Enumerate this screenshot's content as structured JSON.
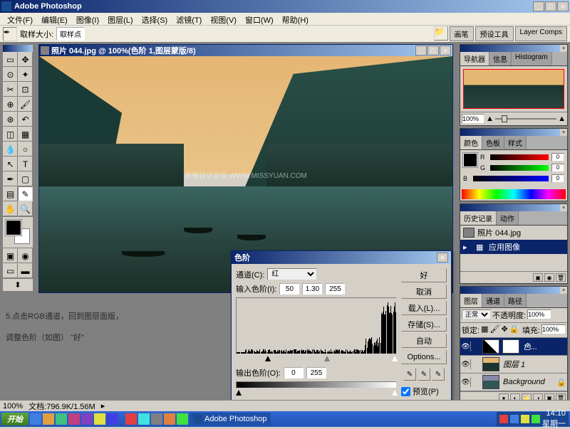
{
  "app": {
    "title": "Adobe Photoshop"
  },
  "menu": [
    "文件(F)",
    "编辑(E)",
    "图像(I)",
    "图层(L)",
    "选择(S)",
    "滤镜(T)",
    "视图(V)",
    "窗口(W)",
    "帮助(H)"
  ],
  "optbar": {
    "label1": "取样大小:",
    "val1": "取样点",
    "tabs": [
      "画笔",
      "预设工具",
      "Layer Comps"
    ]
  },
  "canvas": {
    "title": "照片 044.jpg @ 100%(色阶 1,图层蒙版/8)",
    "watermark": "思缘设计论坛 WWW.MISSYUAN.COM"
  },
  "instruction": {
    "line1": "5.点击RGB通道，回到图层面版，",
    "line2": "调整色阶（如图） \"好\""
  },
  "nav": {
    "tabs": [
      "导航器",
      "信息",
      "Histogram"
    ],
    "zoom": "100%"
  },
  "color": {
    "tabs": [
      "颜色",
      "色板",
      "样式"
    ],
    "r": "0",
    "g": "0",
    "b": "0"
  },
  "history": {
    "tabs": [
      "历史记录",
      "动作"
    ],
    "items": [
      {
        "label": "照片 044.jpg"
      },
      {
        "label": "应用图像"
      }
    ]
  },
  "layers": {
    "tabs": [
      "图层",
      "通道",
      "路径"
    ],
    "mode": "正常",
    "opacity_lbl": "不透明度:",
    "opacity": "100%",
    "lock_lbl": "锁定:",
    "fill_lbl": "填充:",
    "fill": "100%",
    "items": [
      {
        "name": "色...",
        "sel": true
      },
      {
        "name": "图层 1"
      },
      {
        "name": "Background"
      }
    ]
  },
  "levels": {
    "title": "色阶",
    "channel_lbl": "通道(C):",
    "channel": "红",
    "input_lbl": "输入色阶(I):",
    "in1": "50",
    "in2": "1.30",
    "in3": "255",
    "output_lbl": "输出色阶(O):",
    "out1": "0",
    "out2": "255",
    "buttons": {
      "ok": "好",
      "cancel": "取消",
      "load": "载入(L)...",
      "save": "存储(S)...",
      "auto": "自动",
      "options": "Options..."
    },
    "preview": "预览(P)"
  },
  "status": {
    "zoom": "100%",
    "doc": "文档:796.9K/1.56M"
  },
  "taskbar": {
    "start": "开始",
    "app": "Adobe Photoshop",
    "time": "14:10",
    "date": "星期一"
  }
}
